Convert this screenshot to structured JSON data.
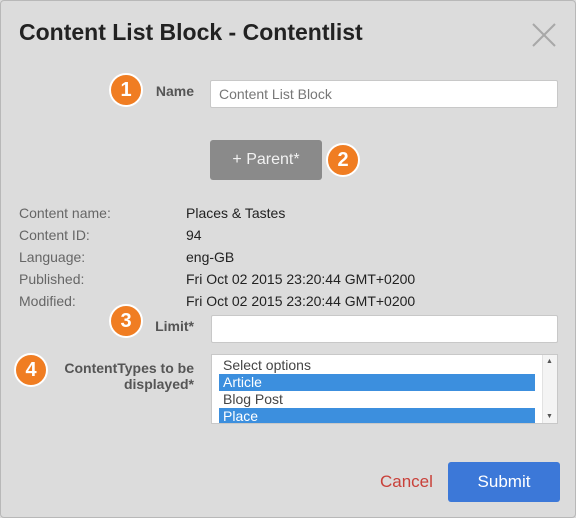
{
  "dialog": {
    "title": "Content List Block - Contentlist",
    "close_icon": "close-icon"
  },
  "badges": [
    "1",
    "2",
    "3",
    "4"
  ],
  "name_field": {
    "label": "Name",
    "placeholder": "Content List Block",
    "value": ""
  },
  "parent_button": {
    "label": "+ Parent*"
  },
  "content_info": [
    {
      "label": "Content name:",
      "value": "Places & Tastes"
    },
    {
      "label": "Content ID:",
      "value": "94"
    },
    {
      "label": "Language:",
      "value": "eng-GB"
    },
    {
      "label": "Published:",
      "value": "Fri Oct 02 2015 23:20:44 GMT+0200"
    },
    {
      "label": "Modified:",
      "value": "Fri Oct 02 2015 23:20:44 GMT+0200"
    }
  ],
  "limit_field": {
    "label": "Limit*",
    "value": ""
  },
  "content_types": {
    "label_line1": "ContentTypes to be",
    "label_line2": "displayed*",
    "options": [
      {
        "label": "Select options",
        "selected": false
      },
      {
        "label": "Article",
        "selected": true
      },
      {
        "label": "Blog Post",
        "selected": false
      },
      {
        "label": "Place",
        "selected": true
      }
    ]
  },
  "footer": {
    "cancel_label": "Cancel",
    "submit_label": "Submit"
  },
  "colors": {
    "badge": "#f07d22",
    "submit": "#3c78d8",
    "cancel": "#c9413a",
    "selection": "#3c8fde"
  }
}
